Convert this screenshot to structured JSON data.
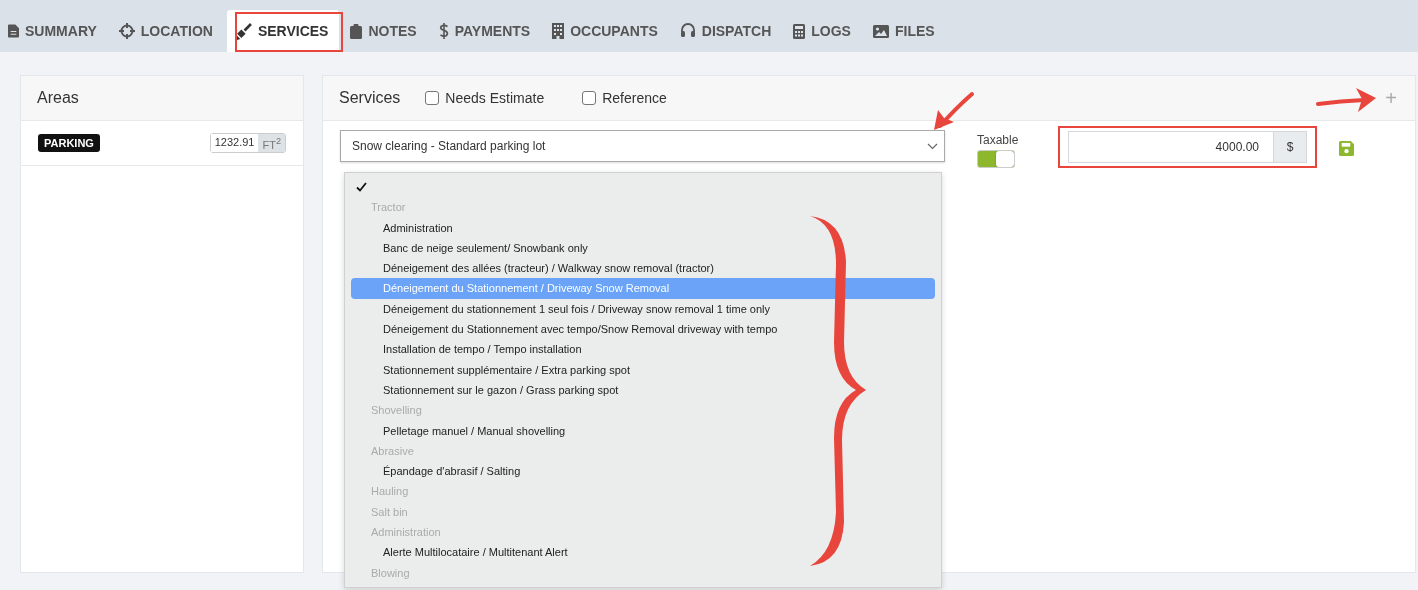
{
  "tabs": [
    {
      "label": "SUMMARY",
      "selected": false
    },
    {
      "label": "LOCATION",
      "selected": false
    },
    {
      "label": "SERVICES",
      "selected": true
    },
    {
      "label": "NOTES",
      "selected": false
    },
    {
      "label": "PAYMENTS",
      "selected": false
    },
    {
      "label": "OCCUPANTS",
      "selected": false
    },
    {
      "label": "DISPATCH",
      "selected": false
    },
    {
      "label": "LOGS",
      "selected": false
    },
    {
      "label": "FILES",
      "selected": false
    }
  ],
  "areas": {
    "title": "Areas",
    "items": [
      {
        "badge": "PARKING",
        "value": "1232.91",
        "unit": "FT$^{2}$"
      }
    ]
  },
  "services": {
    "title": "Services",
    "checkboxes": [
      {
        "label": "Needs Estimate",
        "checked": false
      },
      {
        "label": "Reference",
        "checked": false
      }
    ],
    "add_button": "+",
    "select": {
      "value": "Snow clearing - Standard parking lot"
    },
    "taxable": {
      "label": "Taxable",
      "on": true
    },
    "price": {
      "value": "4000.00",
      "unit": "$"
    },
    "dropdown": [
      {
        "kind": "blank",
        "checked": true
      },
      {
        "kind": "group",
        "label": "Tractor"
      },
      {
        "kind": "option",
        "label": "Administration",
        "selected": false
      },
      {
        "kind": "option",
        "label": "Banc de neige seulement/ Snowbank only",
        "selected": false
      },
      {
        "kind": "option",
        "label": "Déneigement des allées (tracteur) / Walkway snow removal (tractor)",
        "selected": false
      },
      {
        "kind": "option",
        "label": "Déneigement du Stationnement / Driveway Snow Removal",
        "selected": true
      },
      {
        "kind": "option",
        "label": "Déneigement du stationnement 1 seul fois / Driveway snow removal 1 time only",
        "selected": false
      },
      {
        "kind": "option",
        "label": "Déneigement du Stationnement avec tempo/Snow Removal driveway with tempo",
        "selected": false
      },
      {
        "kind": "option",
        "label": "Installation de tempo / Tempo installation",
        "selected": false
      },
      {
        "kind": "option",
        "label": "Stationnement supplémentaire / Extra parking spot",
        "selected": false
      },
      {
        "kind": "option",
        "label": "Stationnement sur le gazon / Grass parking spot",
        "selected": false
      },
      {
        "kind": "group",
        "label": "Shovelling"
      },
      {
        "kind": "option",
        "label": "Pelletage manuel / Manual shovelling",
        "selected": false
      },
      {
        "kind": "group",
        "label": "Abrasive"
      },
      {
        "kind": "option",
        "label": "Épandage d'abrasif / Salting",
        "selected": false
      },
      {
        "kind": "group",
        "label": "Hauling"
      },
      {
        "kind": "group",
        "label": "Salt bin"
      },
      {
        "kind": "group",
        "label": "Administration"
      },
      {
        "kind": "option",
        "label": "Alerte Multilocataire / Multitenant Alert",
        "selected": false
      },
      {
        "kind": "group",
        "label": "Blowing"
      }
    ]
  }
}
